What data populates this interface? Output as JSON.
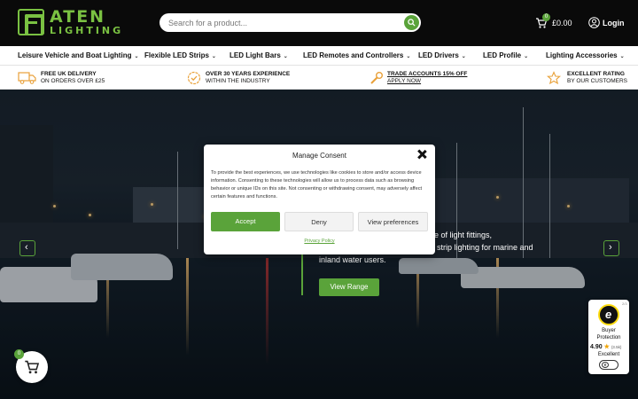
{
  "header": {
    "logo_text_top": "ATEN",
    "logo_text_bottom": "LIGHTING",
    "search_placeholder": "Search for a product...",
    "cart_count": "0",
    "cart_total": "£0.00",
    "login_label": "Login"
  },
  "nav": {
    "items": [
      {
        "label": "Leisure Vehicle and Boat Lighting"
      },
      {
        "label": "Flexible LED Strips"
      },
      {
        "label": "LED Light Bars"
      },
      {
        "label": "LED Remotes and Controllers"
      },
      {
        "label": "LED Drivers"
      },
      {
        "label": "LED Profile"
      },
      {
        "label": "Lighting Accessories"
      }
    ]
  },
  "usp": [
    {
      "line1": "FREE UK DELIVERY",
      "line2": "ON ORDERS OVER £25",
      "icon": "truck-icon"
    },
    {
      "line1": "OVER 30 YEARS EXPERIENCE",
      "line2": "WITHIN THE INDUSTRY",
      "icon": "badge-check-icon"
    },
    {
      "line1": "TRADE ACCOUNTS 15% OFF",
      "line2": "APPLY NOW",
      "icon": "wrench-icon"
    },
    {
      "line1": "EXCELLENT RATING",
      "line2": "BY OUR CUSTOMERS",
      "icon": "star-icon"
    }
  ],
  "hero": {
    "text_line1": "nge of light fittings,",
    "text_line2": "D strip lighting for marine and",
    "text_line3": "inland water users.",
    "button_label": "View Range"
  },
  "consent": {
    "title": "Manage Consent",
    "body": "To provide the best experiences, we use technologies like cookies to store and/or access device information. Consenting to these technologies will allow us to process data such as browsing behavior or unique IDs on this site. Not consenting or withdrawing consent, may adversely affect certain features and functions.",
    "accept_label": "Accept",
    "deny_label": "Deny",
    "prefs_label": "View preferences",
    "policy_label": "Privacy Policy"
  },
  "floating_cart": {
    "count": "0"
  },
  "trust_badge": {
    "small": "2/3",
    "logo_letter": "e",
    "line1": "Buyer",
    "line2": "Protection",
    "rating": "4.90",
    "count": "(3.5k)",
    "label": "Excellent"
  },
  "colors": {
    "accent": "#5aa33a",
    "logo": "#7ac142",
    "header_bg": "#0a0a0a"
  }
}
